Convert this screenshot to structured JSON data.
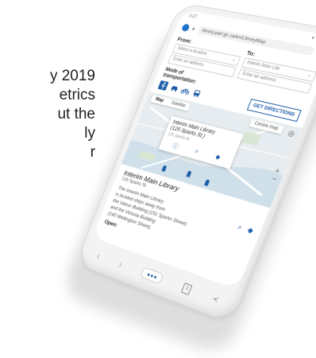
{
  "background_text": {
    "line1": "y 2019",
    "line2": "etrics",
    "line3": "ut the",
    "line4": "ly",
    "line5": "r"
  },
  "statusbar": {
    "time": "4:27",
    "icons": "▾ ◢ ▮"
  },
  "browser": {
    "url": "library.parl.gc.ca/en/LibraryMap",
    "icons": {
      "logo": "browser-logo",
      "lock": "lock-icon",
      "refresh": "refresh-icon"
    }
  },
  "form": {
    "from_label": "From:",
    "to_label": "To:",
    "from_select": "Select a location",
    "to_select": "Interim Main Libr",
    "from_placeholder": "Enter an address",
    "to_placeholder": "Enter an address",
    "mode_label_line1": "Mode of",
    "mode_label_line2": "transportation:",
    "modes": [
      "walk",
      "car",
      "bike",
      "bus"
    ],
    "get_directions": "GET DIRECTIONS"
  },
  "map": {
    "tab_map": "Map",
    "tab_satellite": "Satellite",
    "centre_map": "Centre map",
    "popup_title_line1": "Interim Main Library",
    "popup_title_line2": "(125 Sparks St.)",
    "popup_sub": "125 Sparks St."
  },
  "info": {
    "title": "Interim Main Library",
    "address": "125 Sparks St.",
    "desc_line1": "The Interim Main Library",
    "desc_line2": "is located steps away from",
    "desc_line3": "the Valour Building (151 Sparks Street)",
    "desc_line4": "and the Victoria Building",
    "desc_line5": "(140 Wellington Street).",
    "open_label": "Open:"
  },
  "colors": {
    "accent": "#1f5fa8",
    "map_bg": "#e6ecef",
    "phone_body": "#f3f3f3"
  }
}
